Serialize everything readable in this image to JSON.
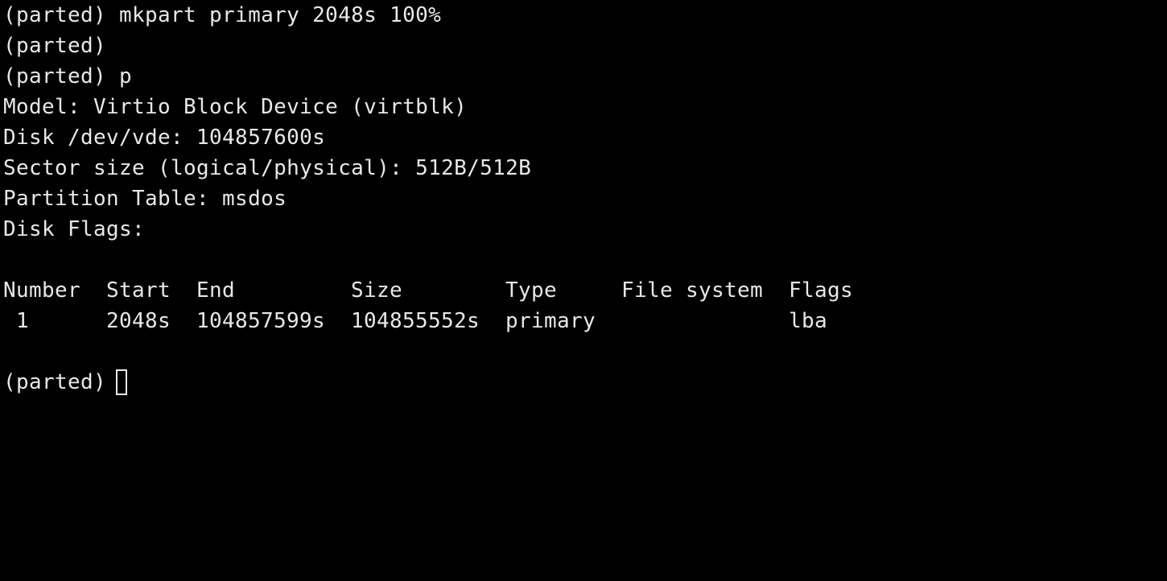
{
  "terminal": {
    "lines": [
      "(parted) mkpart primary 2048s 100%",
      "(parted)",
      "(parted) p",
      "Model: Virtio Block Device (virtblk)",
      "Disk /dev/vde: 104857600s",
      "Sector size (logical/physical): 512B/512B",
      "Partition Table: msdos",
      "Disk Flags:"
    ],
    "table": {
      "headers": {
        "number": "Number",
        "start": "Start",
        "end": "End",
        "size": "Size",
        "type": "Type",
        "file_system": "File system",
        "flags": "Flags"
      },
      "rows": [
        {
          "number": "1",
          "start": "2048s",
          "end": "104857599s",
          "size": "104855552s",
          "type": "primary",
          "file_system": "",
          "flags": "lba"
        }
      ]
    },
    "prompt": "(parted)"
  },
  "colors": {
    "background": "#000000",
    "foreground": "#e8e8e8"
  }
}
